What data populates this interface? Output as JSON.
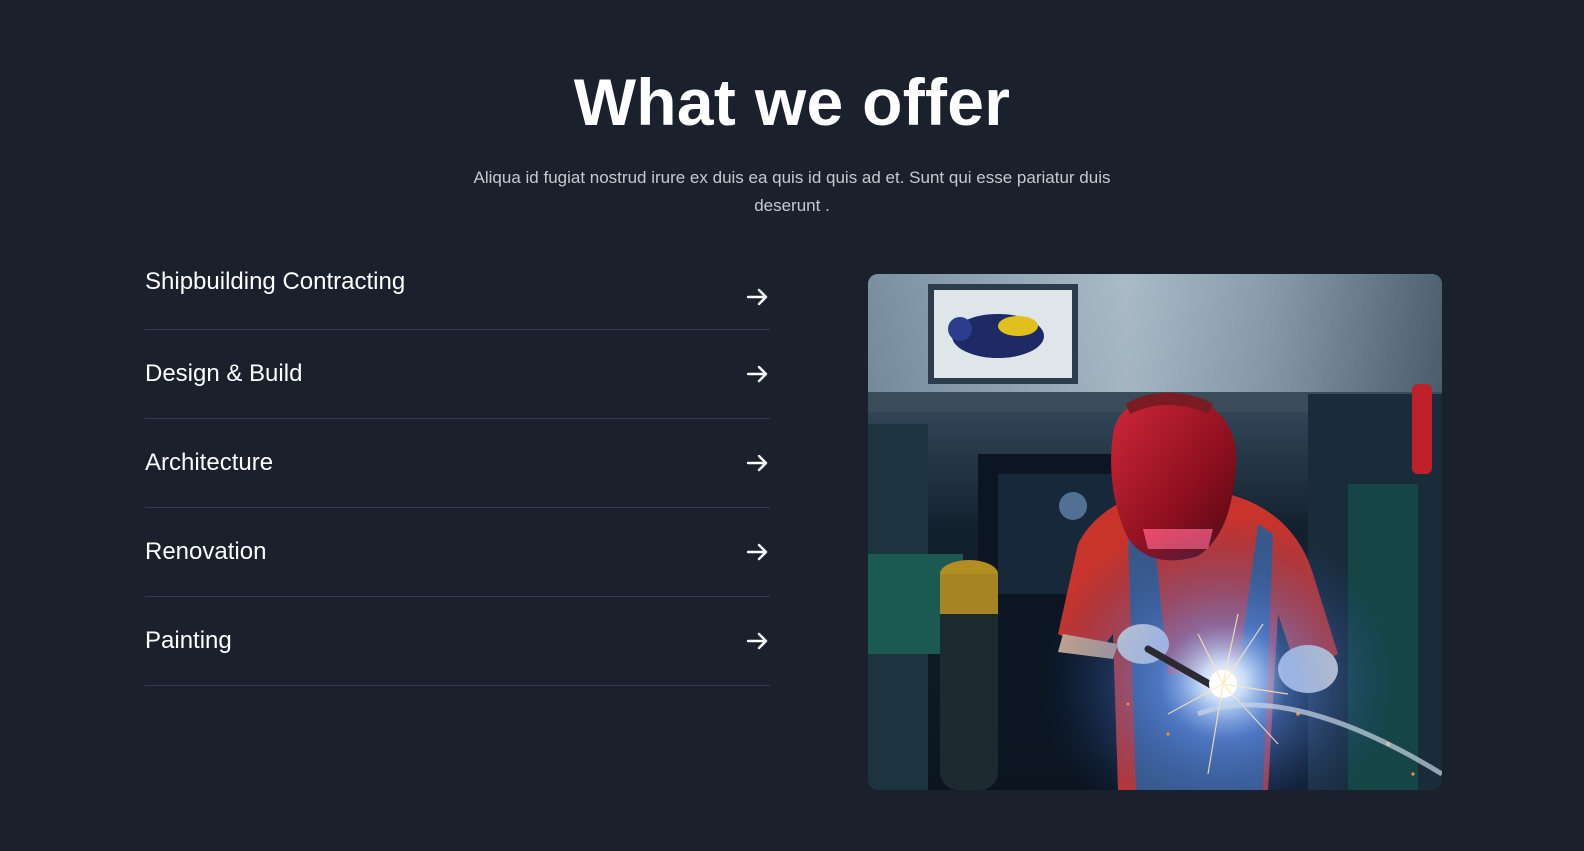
{
  "section": {
    "title": "What we offer",
    "subtitle": "Aliqua id fugiat nostrud irure ex duis ea quis id quis ad et. Sunt qui esse pariatur duis deserunt ."
  },
  "services": [
    {
      "label": "Shipbuilding Contracting",
      "icon": "arrow-right-icon"
    },
    {
      "label": "Design & Build",
      "icon": "arrow-right-icon"
    },
    {
      "label": "Architecture",
      "icon": "arrow-right-icon"
    },
    {
      "label": "Renovation",
      "icon": "arrow-right-icon"
    },
    {
      "label": "Painting",
      "icon": "arrow-right-icon"
    }
  ],
  "image": {
    "subject": "welder-photo"
  },
  "colors": {
    "background": "#1b202d",
    "divider": "#343b4a",
    "text": "#ffffff",
    "muted_text": "#c5c9d2"
  }
}
